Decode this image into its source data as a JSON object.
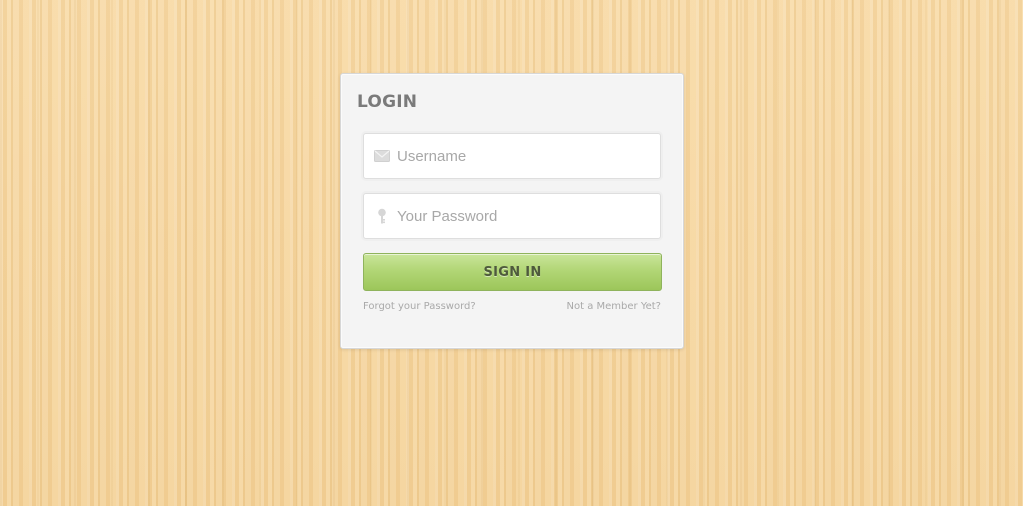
{
  "login": {
    "title": "LOGIN",
    "username": {
      "placeholder": "Username",
      "icon": "envelope-icon"
    },
    "password": {
      "placeholder": "Your Password",
      "icon": "key-icon"
    },
    "submit_label": "SIGN IN",
    "forgot_link": "Forgot your Password?",
    "register_link": "Not a Member Yet?"
  },
  "colors": {
    "background": "#f5d6a2",
    "card": "#f4f4f4",
    "button": "#b2d676",
    "title": "#7a7a7a",
    "link": "#a9a9a9"
  }
}
